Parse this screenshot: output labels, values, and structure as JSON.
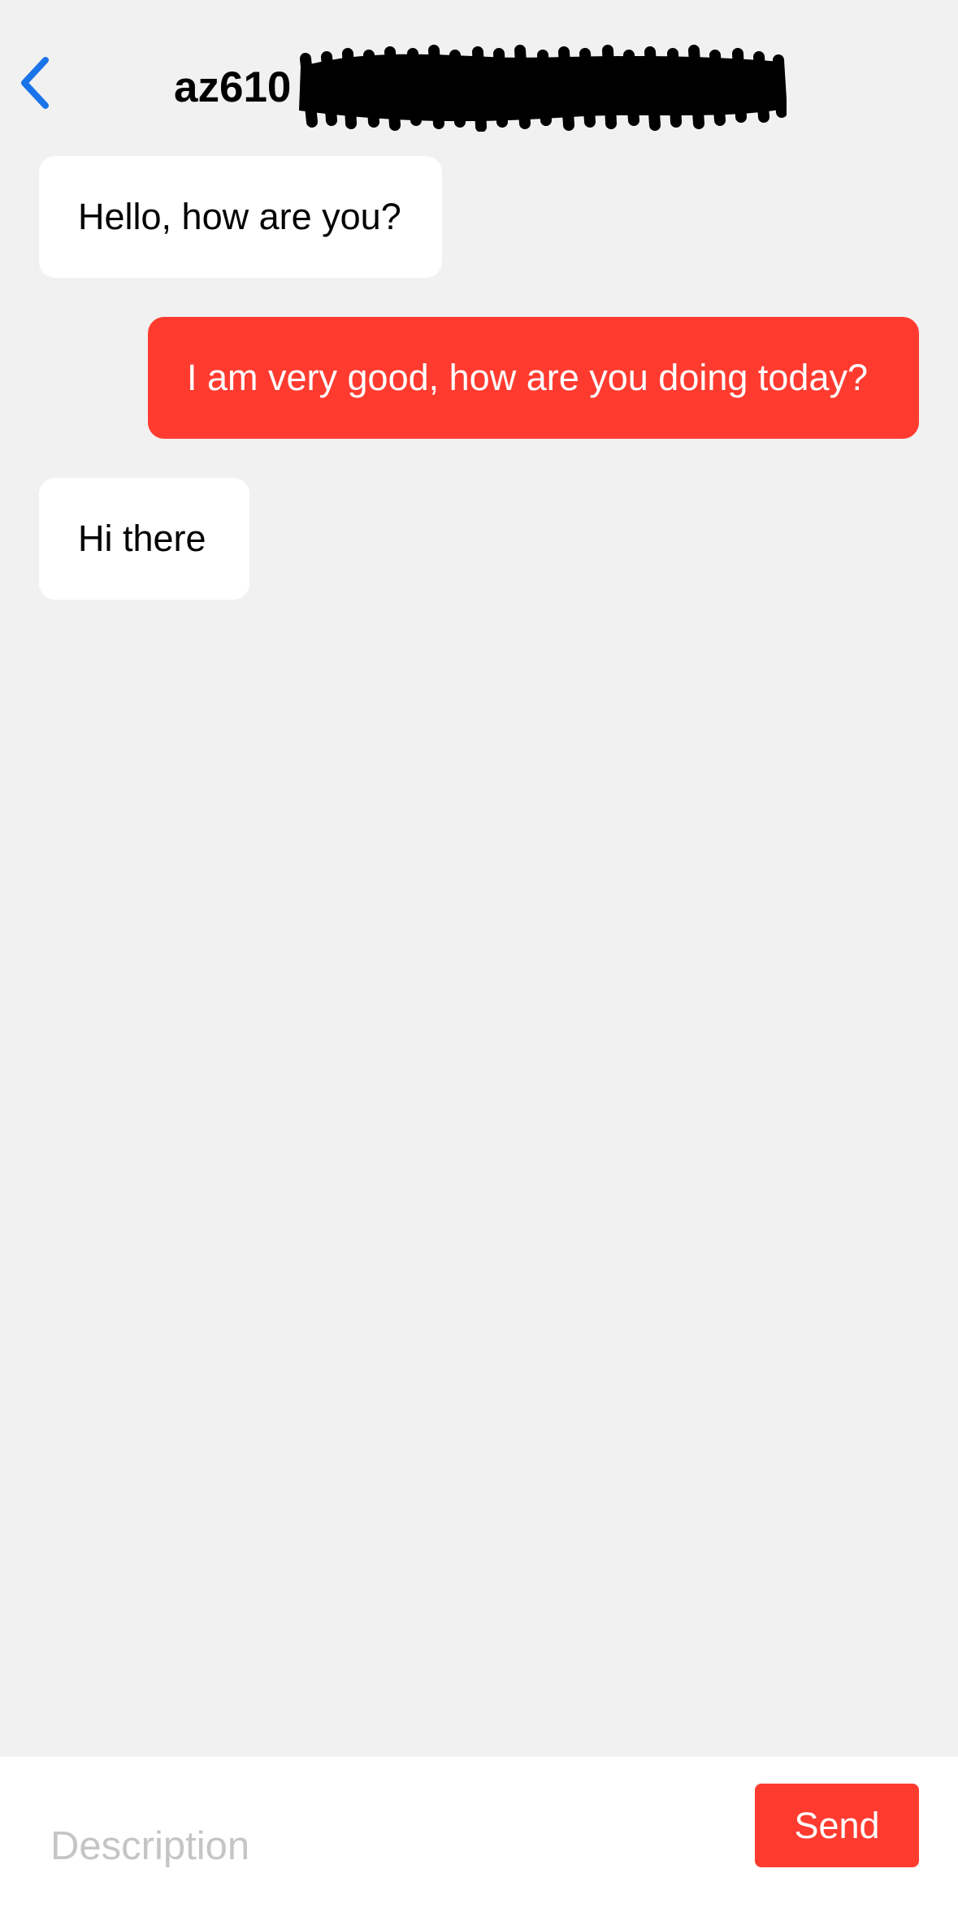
{
  "header": {
    "back_icon": "chevron-left-icon",
    "title": "az610",
    "title_redacted": true
  },
  "messages": [
    {
      "sender": "them",
      "text": "Hello, how are you?"
    },
    {
      "sender": "me",
      "text": "I am very good, how are you doing today?"
    },
    {
      "sender": "them",
      "text": "Hi there"
    }
  ],
  "composer": {
    "placeholder": "Description",
    "value": "",
    "send_label": "Send"
  },
  "colors": {
    "background": "#f1f1f1",
    "accent": "#ff3b30",
    "back_icon": "#1a73e8",
    "incoming_bubble": "#ffffff",
    "placeholder": "#c5c5c7"
  }
}
